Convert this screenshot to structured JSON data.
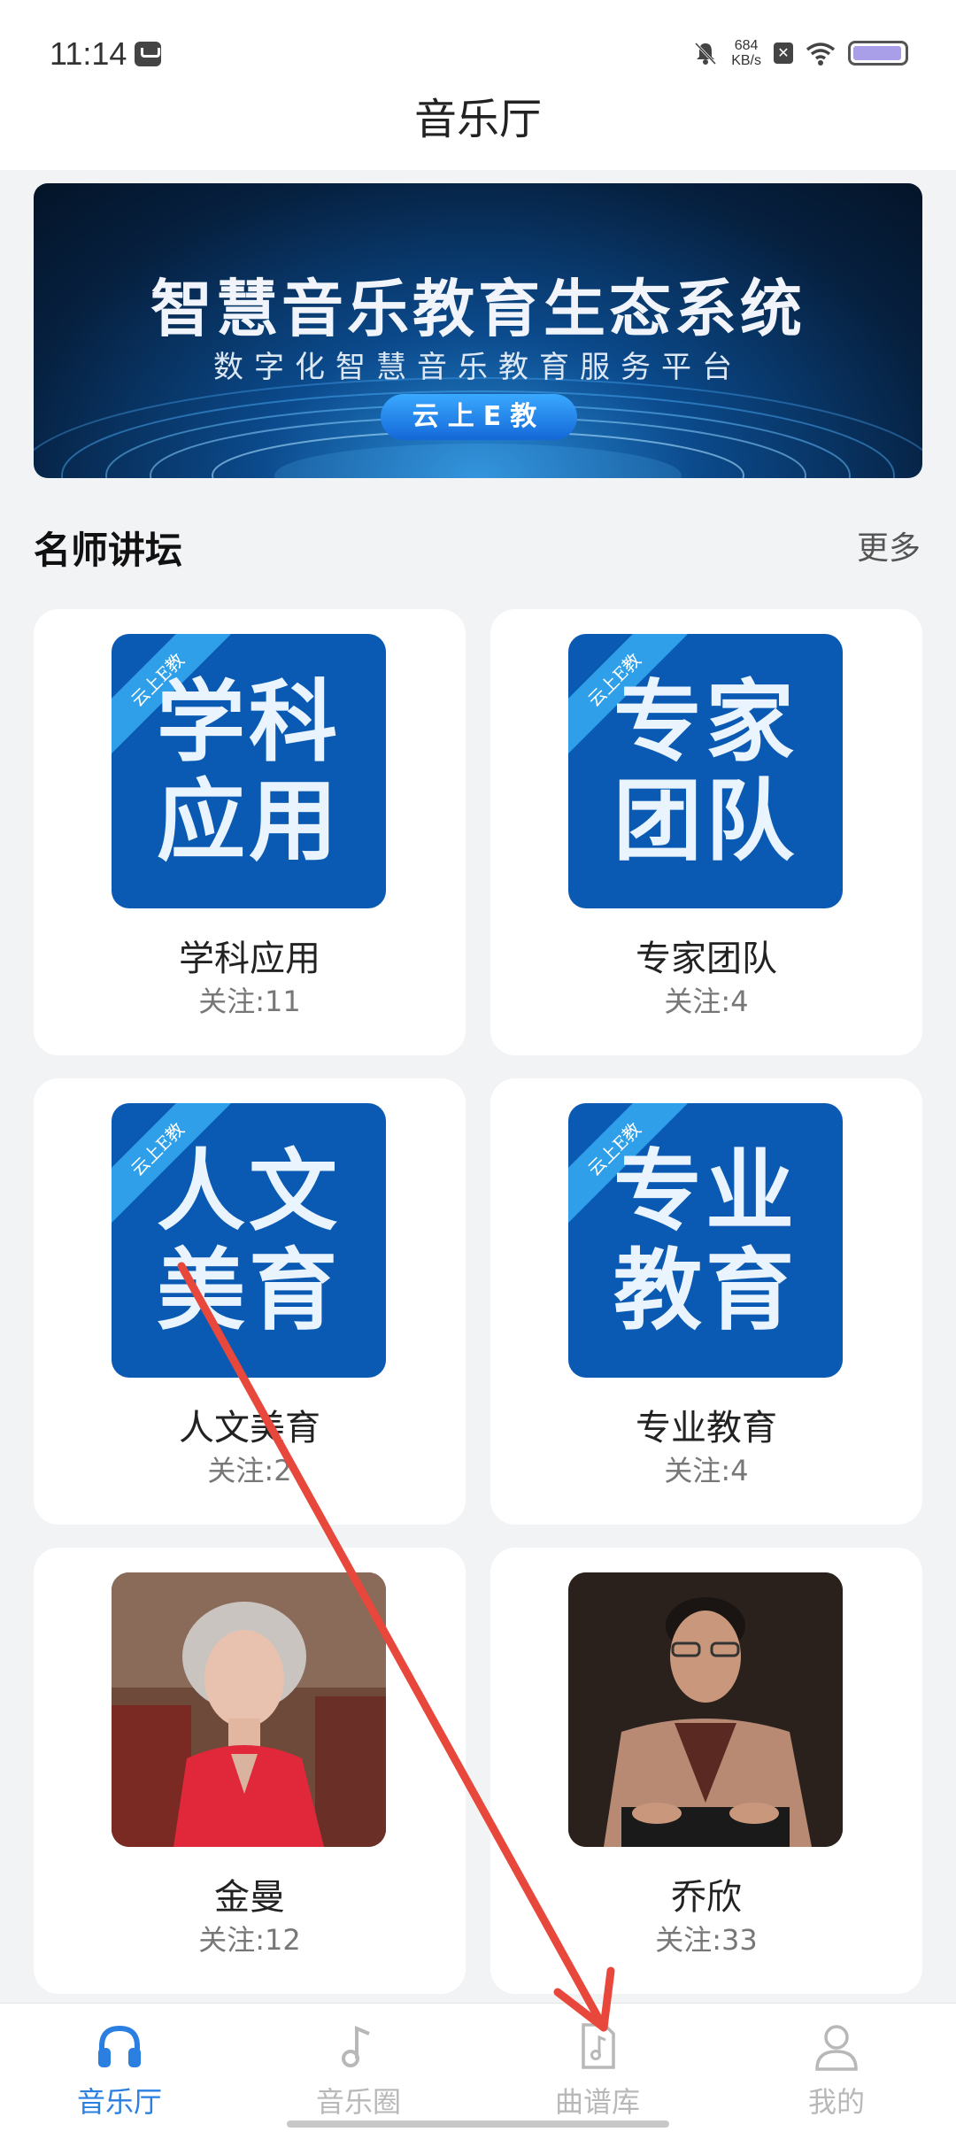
{
  "status_bar": {
    "time": "11:14",
    "net_speed_value": "684",
    "net_speed_unit": "KB/s",
    "icons": [
      "message-icon",
      "mute-bell-icon",
      "close-box-icon",
      "wifi-icon",
      "battery-icon"
    ]
  },
  "header": {
    "title": "音乐厅"
  },
  "banner": {
    "title": "智慧音乐教育生态系统",
    "subtitle": "数字化智慧音乐教育服务平台",
    "badge": "云上E教"
  },
  "section": {
    "title": "名师讲坛",
    "more": "更多"
  },
  "cards": [
    {
      "name": "学科应用",
      "follow": "关注:11",
      "thumb_line1": "学科",
      "thumb_line2": "应用",
      "ribbon": "云上E教",
      "type": "tile"
    },
    {
      "name": "专家团队",
      "follow": "关注:4",
      "thumb_line1": "专家",
      "thumb_line2": "团队",
      "ribbon": "云上E教",
      "type": "tile"
    },
    {
      "name": "人文美育",
      "follow": "关注:2",
      "thumb_line1": "人文",
      "thumb_line2": "美育",
      "ribbon": "云上E教",
      "type": "tile"
    },
    {
      "name": "专业教育",
      "follow": "关注:4",
      "thumb_line1": "专业",
      "thumb_line2": "教育",
      "ribbon": "云上E教",
      "type": "tile"
    },
    {
      "name": "金曼",
      "follow": "关注:12",
      "type": "photo"
    },
    {
      "name": "乔欣",
      "follow": "关注:33",
      "type": "photo"
    }
  ],
  "bottom_nav": [
    {
      "label": "音乐厅",
      "icon": "headphones-icon",
      "active": true
    },
    {
      "label": "音乐圈",
      "icon": "music-note-icon",
      "active": false
    },
    {
      "label": "曲谱库",
      "icon": "music-file-icon",
      "active": false
    },
    {
      "label": "我的",
      "icon": "person-icon",
      "active": false
    }
  ],
  "colors": {
    "accent": "#2a7fe0",
    "tile_blue": "#0a5ab3",
    "overlay_arrow": "#e8473c"
  }
}
